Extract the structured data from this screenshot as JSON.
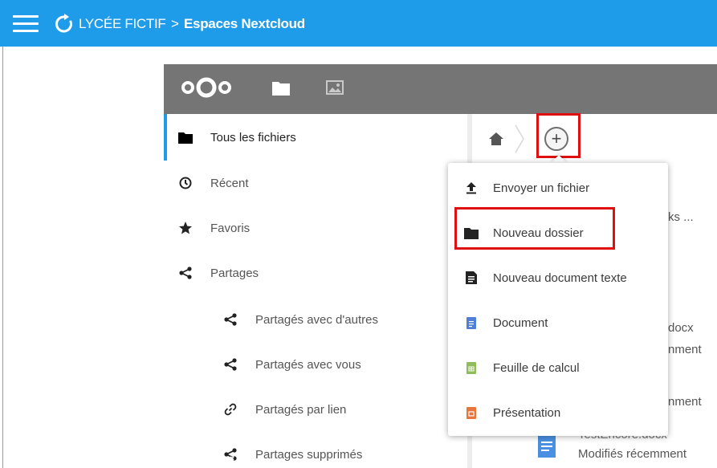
{
  "topbar": {
    "title_prefix": "LYCÉE FICTIF",
    "title_sep": ">",
    "title_bold": "Espaces Nextcloud",
    "bg_color": "#1e9be9",
    "icons": [
      "hamburger-menu-icon",
      "refresh-logo-icon"
    ]
  },
  "nc_header": {
    "icons": [
      "nextcloud-logo-icon",
      "files-folder-icon",
      "photos-icon"
    ],
    "bg_color": "#757575"
  },
  "sidebar": {
    "items": [
      {
        "label": "Tous les fichiers",
        "icon": "folder-icon",
        "active": true
      },
      {
        "label": "Récent",
        "icon": "clock-icon"
      },
      {
        "label": "Favoris",
        "icon": "star-icon"
      },
      {
        "label": "Partages",
        "icon": "share-icon"
      },
      {
        "label": "Partagés avec d'autres",
        "icon": "share-icon"
      },
      {
        "label": "Partagés avec vous",
        "icon": "share-icon"
      },
      {
        "label": "Partagés par lien",
        "icon": "link-icon"
      },
      {
        "label": "Partages supprimés",
        "icon": "share-deleted-icon"
      }
    ],
    "accent_color": "#1e9be9"
  },
  "breadcrumb": {
    "plus": "+",
    "icons": [
      "home-icon",
      "chevron-right-icon"
    ]
  },
  "background": {
    "t1": "ks ...",
    "t2": "docx",
    "t3": "nment",
    "t4": "nment",
    "t5": "TestEncore.docx",
    "t6": "Modifiés récemment"
  },
  "new_menu": {
    "items": [
      {
        "label": "Envoyer un fichier",
        "icon": "upload-icon"
      },
      {
        "label": "Nouveau dossier",
        "icon": "folder-icon"
      },
      {
        "label": "Nouveau document texte",
        "icon": "text-document-icon"
      },
      {
        "label": "Document",
        "icon": "document-icon",
        "color": "#4f7fd6"
      },
      {
        "label": "Feuille de calcul",
        "icon": "spreadsheet-icon",
        "color": "#8fbd5a"
      },
      {
        "label": "Présentation",
        "icon": "presentation-icon",
        "color": "#e8753a"
      }
    ],
    "highlight_color": "#e01010"
  }
}
